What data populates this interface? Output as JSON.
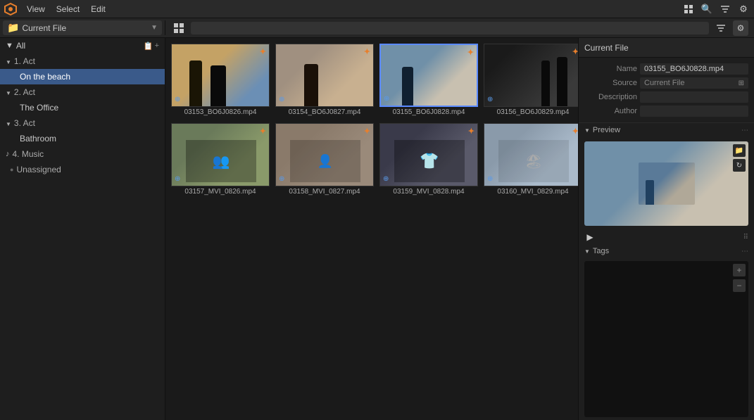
{
  "topbar": {
    "menu_items": [
      "View",
      "Select",
      "Edit"
    ],
    "logo_symbol": "⬡"
  },
  "second_toolbar": {
    "current_file_label": "Current File",
    "current_file_icon": "📁",
    "search_placeholder": "",
    "grid_icon": "⊞",
    "filter_icon": "⊟",
    "settings_icon": "⚙"
  },
  "sidebar": {
    "all_label": "All",
    "group1": {
      "label": "1. Act",
      "items": [
        {
          "label": "On the beach",
          "active": true
        }
      ]
    },
    "group2": {
      "label": "2. Act",
      "items": [
        {
          "label": "The Office",
          "active": false
        }
      ]
    },
    "group3": {
      "label": "3. Act",
      "items": [
        {
          "label": "Bathroom",
          "active": false
        }
      ]
    },
    "music": {
      "label": "4. Music"
    },
    "unassigned": {
      "label": "Unassigned"
    }
  },
  "media_items": [
    {
      "id": 0,
      "filename": "03153_BO6J0826.mp4",
      "thumb_class": "thumb-beach1"
    },
    {
      "id": 1,
      "filename": "03154_BO6J0827.mp4",
      "thumb_class": "thumb-beach2"
    },
    {
      "id": 2,
      "filename": "03155_BO6J0828.mp4",
      "thumb_class": "thumb-beach3",
      "selected": true
    },
    {
      "id": 3,
      "filename": "03156_BO6J0829.mp4",
      "thumb_class": "thumb-beach4"
    },
    {
      "id": 4,
      "filename": "03157_MVI_0826.mp4",
      "thumb_class": "thumb-group1"
    },
    {
      "id": 5,
      "filename": "03158_MVI_0827.mp4",
      "thumb_class": "thumb-group2"
    },
    {
      "id": 6,
      "filename": "03159_MVI_0828.mp4",
      "thumb_class": "thumb-group3"
    },
    {
      "id": 7,
      "filename": "03160_MVI_0829.mp4",
      "thumb_class": "thumb-group4"
    }
  ],
  "right_panel": {
    "header_label": "Current File",
    "name_label": "Name",
    "name_value": "03155_BO6J0828.mp4",
    "source_label": "Source",
    "source_value": "Current File",
    "description_label": "Description",
    "description_value": "",
    "author_label": "Author",
    "author_value": "",
    "preview_label": "Preview",
    "tags_label": "Tags",
    "play_symbol": "▶",
    "add_symbol": "+",
    "minus_symbol": "−",
    "folder_symbol": "📁",
    "refresh_symbol": "↻",
    "dots_symbol": "⋯"
  }
}
